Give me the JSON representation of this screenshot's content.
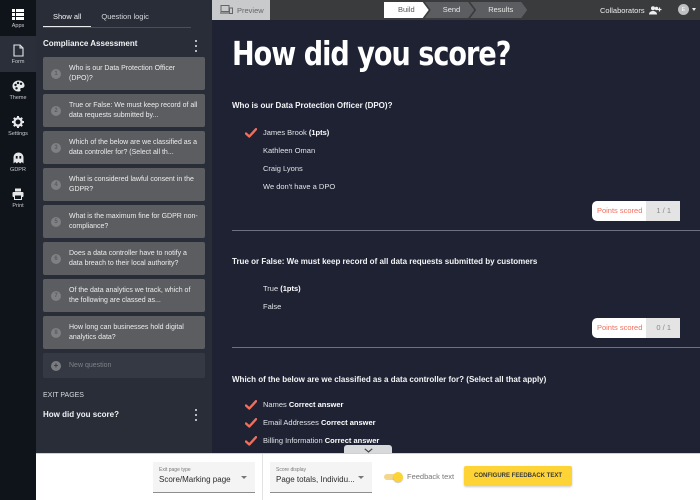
{
  "rail": {
    "items": [
      {
        "label": "Apps",
        "icon": "apps-list-icon",
        "active": false
      },
      {
        "label": "Form",
        "icon": "form-document-icon",
        "active": true
      },
      {
        "label": "Theme",
        "icon": "palette-icon",
        "active": false
      },
      {
        "label": "Settings",
        "icon": "gear-icon",
        "active": false
      },
      {
        "label": "GDPR",
        "icon": "ghost-icon",
        "active": false
      },
      {
        "label": "Print",
        "icon": "printer-icon",
        "active": false
      }
    ]
  },
  "sidebar": {
    "tabs": [
      {
        "label": "Show all",
        "active": true
      },
      {
        "label": "Question logic",
        "active": false
      }
    ],
    "form_title": "Compliance Assessment",
    "questions": [
      {
        "num": "1",
        "text": "Who is our Data Protection Officer (DPO)?"
      },
      {
        "num": "2",
        "text": "True or False: We must keep record of all data requests submitted by..."
      },
      {
        "num": "3",
        "text": "Which of the below are we classified as a data controller for? (Select all th..."
      },
      {
        "num": "4",
        "text": "What is considered lawful consent in the GDPR?"
      },
      {
        "num": "5",
        "text": "What is the maximum fine for GDPR non-compliance?"
      },
      {
        "num": "6",
        "text": "Does a data controller have to notify a data breach to their local authority?"
      },
      {
        "num": "7",
        "text": "Of the data analytics we track, which of the following are classed as..."
      },
      {
        "num": "8",
        "text": "How long can businesses hold digital analytics data?"
      }
    ],
    "new_question": {
      "icon": "+",
      "label": "New question"
    },
    "exit_pages_label": "EXIT PAGES",
    "exit_pages": [
      {
        "label": "How did you score?"
      }
    ]
  },
  "topbar": {
    "preview_label": "Preview",
    "steps": [
      {
        "label": "Build",
        "active": true
      },
      {
        "label": "Send",
        "active": false
      },
      {
        "label": "Results",
        "active": false
      }
    ],
    "collaborators_label": "Collaborators",
    "avatar_initial": "E"
  },
  "main": {
    "title": "How did you score?",
    "questions": [
      {
        "heading": "Who is our Data Protection Officer (DPO)?",
        "answers": [
          {
            "text": "James Brook",
            "suffix": "(1pts)",
            "checked": true
          },
          {
            "text": "Kathleen Oman",
            "suffix": "",
            "checked": false
          },
          {
            "text": "Craig Lyons",
            "suffix": "",
            "checked": false
          },
          {
            "text": "We don't have a DPO",
            "suffix": "",
            "checked": false
          }
        ],
        "points_label": "Points scored",
        "points_value": "1 / 1"
      },
      {
        "heading": "True or False: We must keep record of all data requests submitted by customers",
        "answers": [
          {
            "text": "True",
            "suffix": "(1pts)",
            "checked": false
          },
          {
            "text": "False",
            "suffix": "",
            "checked": false
          }
        ],
        "points_label": "Points scored",
        "points_value": "0 / 1"
      },
      {
        "heading": "Which of the below are we classified as a data controller for? (Select all that apply)",
        "answers": [
          {
            "text": "Names",
            "suffix": "Correct answer",
            "checked": true
          },
          {
            "text": "Email Addresses",
            "suffix": "Correct answer",
            "checked": true
          },
          {
            "text": "Billing Information",
            "suffix": "Correct answer",
            "checked": true
          }
        ]
      }
    ]
  },
  "bottombar": {
    "exit_page_type": {
      "label": "Exit page type",
      "value": "Score/Marking page"
    },
    "score_display": {
      "label": "Score display",
      "value": "Page totals, Individu..."
    },
    "feedback_toggle": {
      "label": "Feedback text",
      "on": true
    },
    "configure_button": "CONFIGURE FEEDBACK TEXT"
  },
  "colors": {
    "accent_check": "#ef6f5c",
    "accent_yellow": "#fdd335",
    "main_bg": "#1e2233",
    "sidebar_bg": "#282d38"
  }
}
